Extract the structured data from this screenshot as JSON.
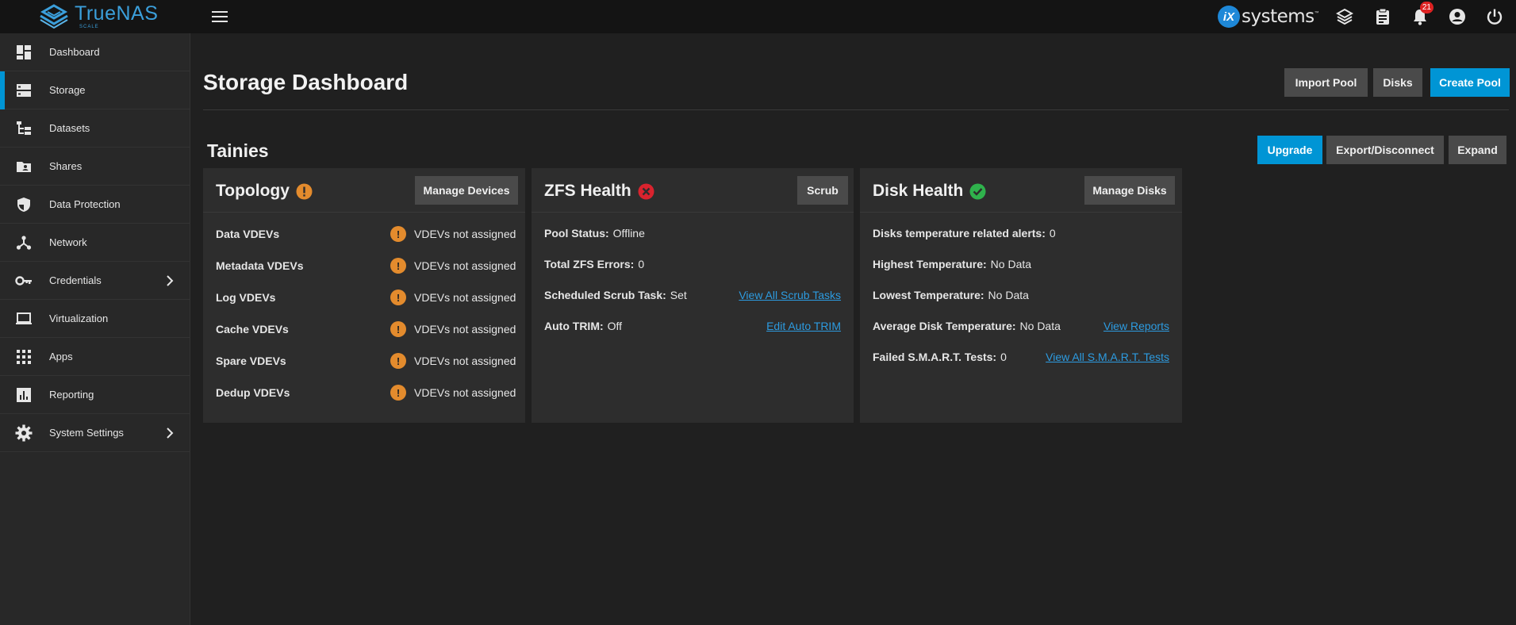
{
  "brand": {
    "name": "TrueNAS",
    "edition": "SCALE",
    "vendor_mark": "iX",
    "vendor_text": "systems",
    "vendor_tm": "™"
  },
  "notifications": {
    "count": "21"
  },
  "sidebar": {
    "items": [
      {
        "label": "Dashboard",
        "icon": "dashboard-icon"
      },
      {
        "label": "Storage",
        "icon": "storage-icon",
        "active": true
      },
      {
        "label": "Datasets",
        "icon": "datasets-icon"
      },
      {
        "label": "Shares",
        "icon": "shares-icon"
      },
      {
        "label": "Data Protection",
        "icon": "shield-icon"
      },
      {
        "label": "Network",
        "icon": "network-icon"
      },
      {
        "label": "Credentials",
        "icon": "key-icon",
        "expandable": true
      },
      {
        "label": "Virtualization",
        "icon": "laptop-icon"
      },
      {
        "label": "Apps",
        "icon": "apps-grid-icon"
      },
      {
        "label": "Reporting",
        "icon": "chart-icon"
      },
      {
        "label": "System Settings",
        "icon": "gear-icon",
        "expandable": true
      }
    ]
  },
  "page": {
    "title": "Storage Dashboard",
    "actions": {
      "import_pool": "Import Pool",
      "disks": "Disks",
      "create_pool": "Create Pool"
    }
  },
  "pool": {
    "name": "Tainies",
    "actions": {
      "upgrade": "Upgrade",
      "export": "Export/Disconnect",
      "expand": "Expand"
    }
  },
  "topology": {
    "title": "Topology",
    "status": "warning",
    "button": "Manage Devices",
    "rows": [
      {
        "label": "Data VDEVs",
        "value": "VDEVs not assigned"
      },
      {
        "label": "Metadata VDEVs",
        "value": "VDEVs not assigned"
      },
      {
        "label": "Log VDEVs",
        "value": "VDEVs not assigned"
      },
      {
        "label": "Cache VDEVs",
        "value": "VDEVs not assigned"
      },
      {
        "label": "Spare VDEVs",
        "value": "VDEVs not assigned"
      },
      {
        "label": "Dedup VDEVs",
        "value": "VDEVs not assigned"
      }
    ]
  },
  "zfs_health": {
    "title": "ZFS Health",
    "status": "error",
    "button": "Scrub",
    "pool_status_label": "Pool Status:",
    "pool_status": "Offline",
    "errors_label": "Total ZFS Errors:",
    "errors": "0",
    "scrub_label": "Scheduled Scrub Task:",
    "scrub": "Set",
    "scrub_link": "View All Scrub Tasks",
    "trim_label": "Auto TRIM:",
    "trim": "Off",
    "trim_link": "Edit Auto TRIM"
  },
  "disk_health": {
    "title": "Disk Health",
    "status": "ok",
    "button": "Manage Disks",
    "temp_alerts_label": "Disks temperature related alerts:",
    "temp_alerts": "0",
    "highest_label": "Highest Temperature:",
    "highest": "No Data",
    "lowest_label": "Lowest Temperature:",
    "lowest": "No Data",
    "average_label": "Average Disk Temperature:",
    "average": "No Data",
    "reports_link": "View Reports",
    "smart_label": "Failed S.M.A.R.T. Tests:",
    "smart": "0",
    "smart_link": "View All S.M.A.R.T. Tests"
  },
  "colors": {
    "accent": "#0095d5",
    "warning": "#e38b2d",
    "error": "#d9232e",
    "ok": "#2fb24c",
    "link": "#2d9be0"
  }
}
